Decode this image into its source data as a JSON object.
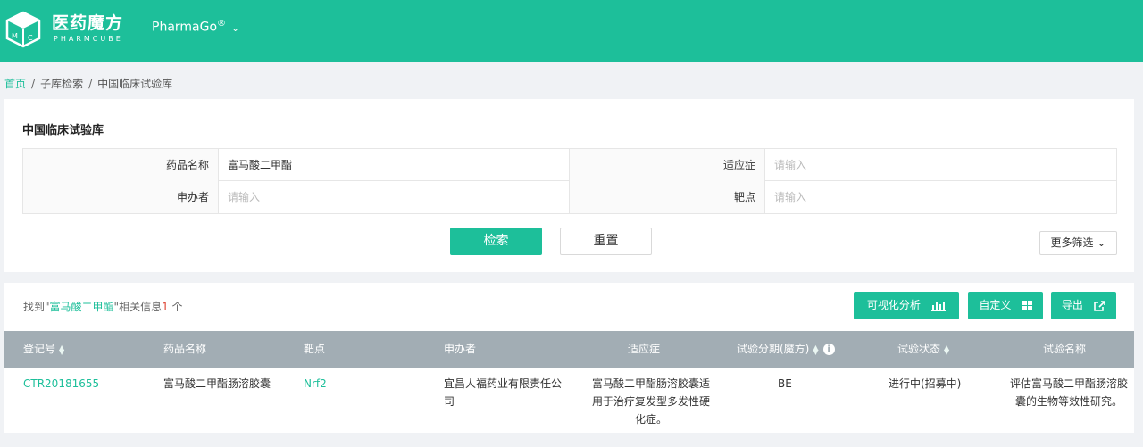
{
  "header": {
    "logo_cn": "医药魔方",
    "logo_en": "PHARMCUBE",
    "product": "PharmaGo",
    "product_mark": "®"
  },
  "breadcrumb": {
    "home": "首页",
    "level2": "子库检索",
    "current": "中国临床试验库",
    "separator": "/"
  },
  "search_panel": {
    "title": "中国临床试验库",
    "fields": {
      "drug_name": {
        "label": "药品名称",
        "value": "富马酸二甲酯"
      },
      "indication": {
        "label": "适应症",
        "placeholder": "请输入"
      },
      "sponsor": {
        "label": "申办者",
        "placeholder": "请输入"
      },
      "target": {
        "label": "靶点",
        "placeholder": "请输入"
      }
    },
    "search_label": "检索",
    "reset_label": "重置",
    "more_filters_label": "更多筛选"
  },
  "results": {
    "found_prefix": "找到\"",
    "keyword": "富马酸二甲酯",
    "found_middle": "\"相关信息",
    "count": "1",
    "found_suffix": "个",
    "actions": {
      "visualize": "可视化分析",
      "customize": "自定义",
      "export": "导出"
    },
    "columns": {
      "reg_no": "登记号",
      "drug_name": "药品名称",
      "target": "靶点",
      "sponsor": "申办者",
      "indication": "适应症",
      "phase": "试验分期(魔方)",
      "status": "试验状态",
      "trial_name": "试验名称"
    },
    "rows": [
      {
        "reg_no": "CTR20181655",
        "drug_name": "富马酸二甲酯肠溶胶囊",
        "target": "Nrf2",
        "sponsor_l1": "宜昌人福药业有限责任公",
        "sponsor_l2": "司",
        "indication_l1": "富马酸二甲酯肠溶胶囊适",
        "indication_l2": "用于治疗复发型多发性硬",
        "indication_l3": "化症。",
        "phase": "BE",
        "status": "进行中(招募中)",
        "trial_name_l1": "评估富马酸二甲酯肠溶胶",
        "trial_name_l2": "囊的生物等效性研究。"
      }
    ]
  },
  "colors": {
    "brand": "#1dbf9a",
    "table_header": "#a2adb4",
    "count": "#e04a3a"
  },
  "icons": [
    "cube-logo-icon",
    "chevron-down-icon",
    "sort-icon",
    "info-icon",
    "bar-chart-icon",
    "grid-icon",
    "export-icon"
  ]
}
